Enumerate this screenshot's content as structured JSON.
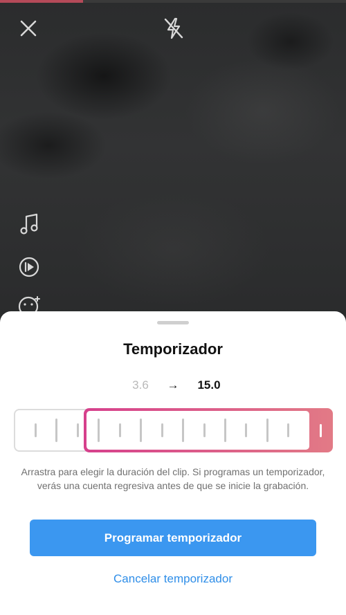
{
  "recording": {
    "progress": 0.24
  },
  "top_bar": {
    "close_icon": "close-icon",
    "flash_icon": "flash-off-icon"
  },
  "side_tools": [
    {
      "icon": "music-note-icon"
    },
    {
      "icon": "playback-speed-icon"
    },
    {
      "icon": "effects-icon"
    }
  ],
  "sheet": {
    "title": "Temporizador",
    "range_start": "3.6",
    "range_arrow": "→",
    "range_end": "15.0",
    "help_text": "Arrastra para elegir la duración del clip. Si programas un temporizador, verás una cuenta regresiva antes de que se inicie la grabación.",
    "primary_button": "Programar temporizador",
    "secondary_button": "Cancelar temporizador"
  },
  "colors": {
    "primary": "#3b97f0",
    "link": "#2f8ee8",
    "selection_start": "#d6408c",
    "selection_end": "#e27a86"
  }
}
